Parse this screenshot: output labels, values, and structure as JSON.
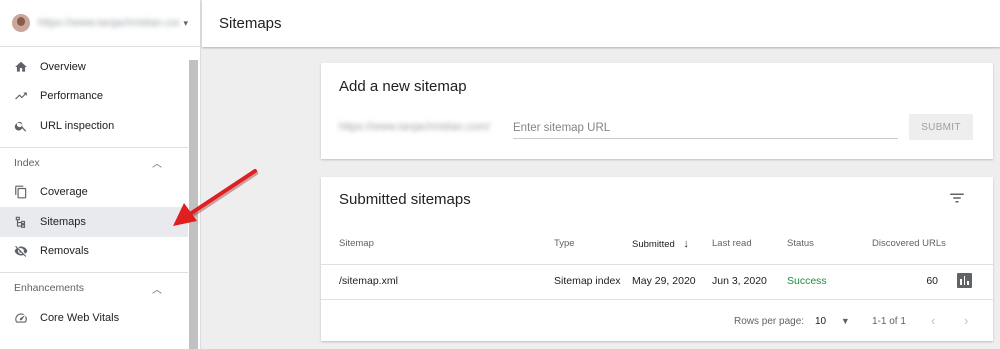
{
  "sidebar": {
    "property_url": "https://www.tanjachristian.com/",
    "items_top": [
      {
        "label": "Overview",
        "icon": "home-icon"
      },
      {
        "label": "Performance",
        "icon": "trending-up-icon"
      },
      {
        "label": "URL inspection",
        "icon": "search-icon"
      }
    ],
    "index_section": "Index",
    "items_index": [
      {
        "label": "Coverage",
        "icon": "copy-icon"
      },
      {
        "label": "Sitemaps",
        "icon": "sitemap-icon"
      },
      {
        "label": "Removals",
        "icon": "eye-off-icon"
      }
    ],
    "enhancements_section": "Enhancements",
    "items_enh": [
      {
        "label": "Core Web Vitals",
        "icon": "speed-icon"
      }
    ]
  },
  "header": {
    "title": "Sitemaps"
  },
  "add_card": {
    "title": "Add a new sitemap",
    "prefix": "https://www.tanjachristian.com/",
    "placeholder": "Enter sitemap URL",
    "submit_label": "SUBMIT"
  },
  "submitted_card": {
    "title": "Submitted sitemaps",
    "columns": {
      "sitemap": "Sitemap",
      "type": "Type",
      "submitted": "Submitted",
      "last_read": "Last read",
      "status": "Status",
      "discovered": "Discovered URLs"
    },
    "rows": [
      {
        "sitemap": "/sitemap.xml",
        "type": "Sitemap index",
        "submitted": "May 29, 2020",
        "last_read": "Jun 3, 2020",
        "status": "Success",
        "discovered": "60"
      }
    ],
    "footer": {
      "rows_per_page_label": "Rows per page:",
      "rows_per_page_value": "10",
      "range": "1-1 of 1"
    }
  },
  "colors": {
    "success": "#1e8e3e",
    "annotation_arrow": "#e02020"
  }
}
